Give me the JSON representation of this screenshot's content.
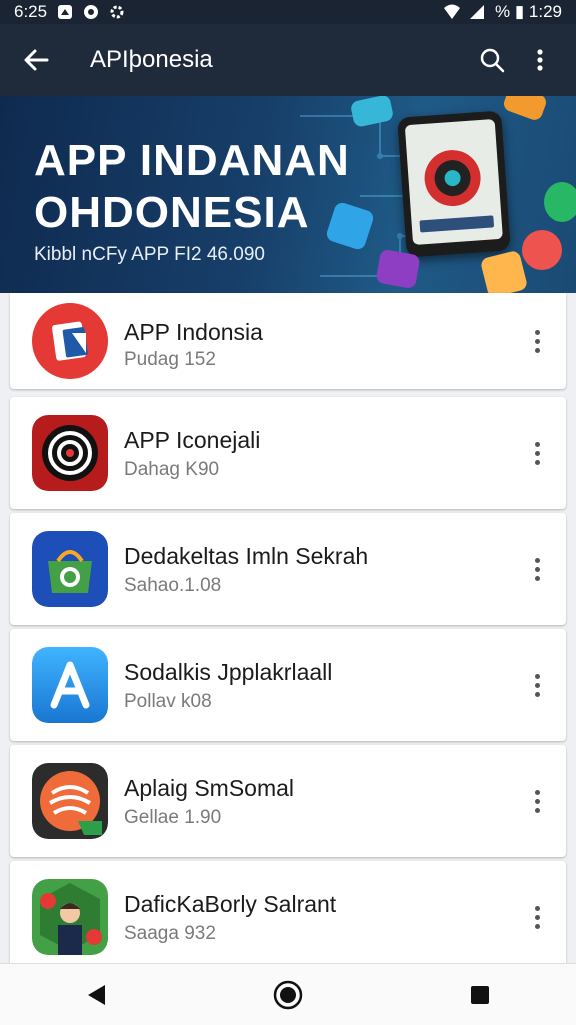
{
  "status_bar": {
    "time": "6:25",
    "right_text": "% ▮ 1:29"
  },
  "app_bar": {
    "title": "APIþonesia"
  },
  "banner": {
    "line1": "APP INDANAN",
    "line2": "OHDONESIA",
    "line3": "Kibbl nCFy APP FI2 46.090"
  },
  "apps": [
    {
      "name": "APP Indonsia",
      "sub": "Pudag 152",
      "icon": "red-app-icon",
      "color": "#e53935"
    },
    {
      "name": "APP Iconejali",
      "sub": "Dahag K90",
      "icon": "target-app-icon",
      "color": "#b71c1c"
    },
    {
      "name": "Dedakeltas Imln Sekrah",
      "sub": "Sahao.1.08",
      "icon": "green-bag-app-icon",
      "color": "#2e7d32"
    },
    {
      "name": "Sodalkis Jpplakrlaall",
      "sub": "Pollav k08",
      "icon": "letter-a-app-icon",
      "color": "#2196f3"
    },
    {
      "name": "Aplaig SmSomal",
      "sub": "Gellae 1.90",
      "icon": "orange-swirl-app-icon",
      "color": "#ef6c3a"
    },
    {
      "name": "DaficKaBorly Salrant",
      "sub": "Saaga 932",
      "icon": "character-app-icon",
      "color": "#43a047"
    }
  ],
  "colors": {
    "app_bar": "#1f2a3a",
    "status_bar": "#1a2433",
    "card": "#ffffff"
  }
}
